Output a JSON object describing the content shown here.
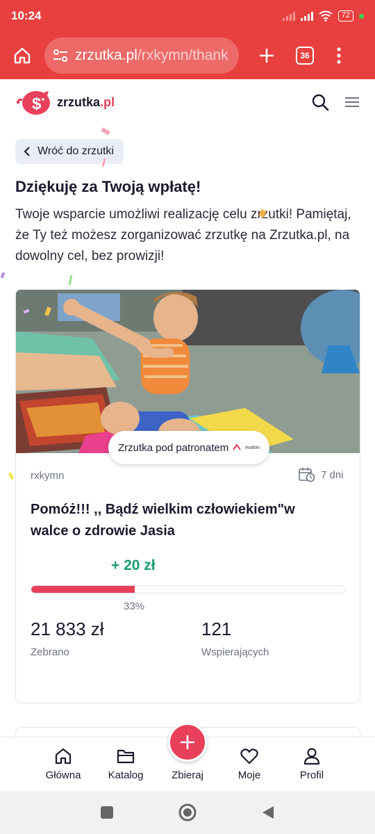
{
  "status_bar": {
    "time": "10:24",
    "battery": "72"
  },
  "browser": {
    "url_domain": "zrzutka.pl",
    "url_path": "/rxkymn/thank",
    "tab_count": "36"
  },
  "site": {
    "logo_text": "zrzutka",
    "logo_tld": ".pl"
  },
  "back_button": {
    "label": "Wróć do zrzutki"
  },
  "thanks": {
    "title": "Dziękuję za Twoją wpłatę!",
    "text": "Twoje wsparcie umożliwi realizację celu zrzutki! Pamiętaj, że Ty też możesz zorganizować zrzutkę na Zrzutka.pl, na dowolny cel, bez prowizji!"
  },
  "campaign": {
    "patron_label": "Zrzutka pod patronatem",
    "patron_logo_text": "evalon",
    "organizer": "rxkymn",
    "days_left": "7 dni",
    "title": "Pomóż!!! ,, Bądź wielkim człowiekiem\"w walce o zdrowie Jasia",
    "recent_donation": "+ 20 zł",
    "progress_fraction": 0.33,
    "progress_label": "33%",
    "amount": "21 833 zł",
    "amount_label": "Zebrano",
    "supporters": "121",
    "supporters_label": "Wspierających"
  },
  "bottom_nav": {
    "items": [
      {
        "label": "Główna",
        "icon": "home-icon"
      },
      {
        "label": "Katalog",
        "icon": "folder-icon"
      },
      {
        "label": "Zbieraj",
        "icon": "plus-icon"
      },
      {
        "label": "Moje",
        "icon": "heart-icon"
      },
      {
        "label": "Profil",
        "icon": "user-icon"
      }
    ]
  },
  "colors": {
    "brand": "#e8403f",
    "accent": "#e8405a",
    "success": "#1a9c6c"
  }
}
